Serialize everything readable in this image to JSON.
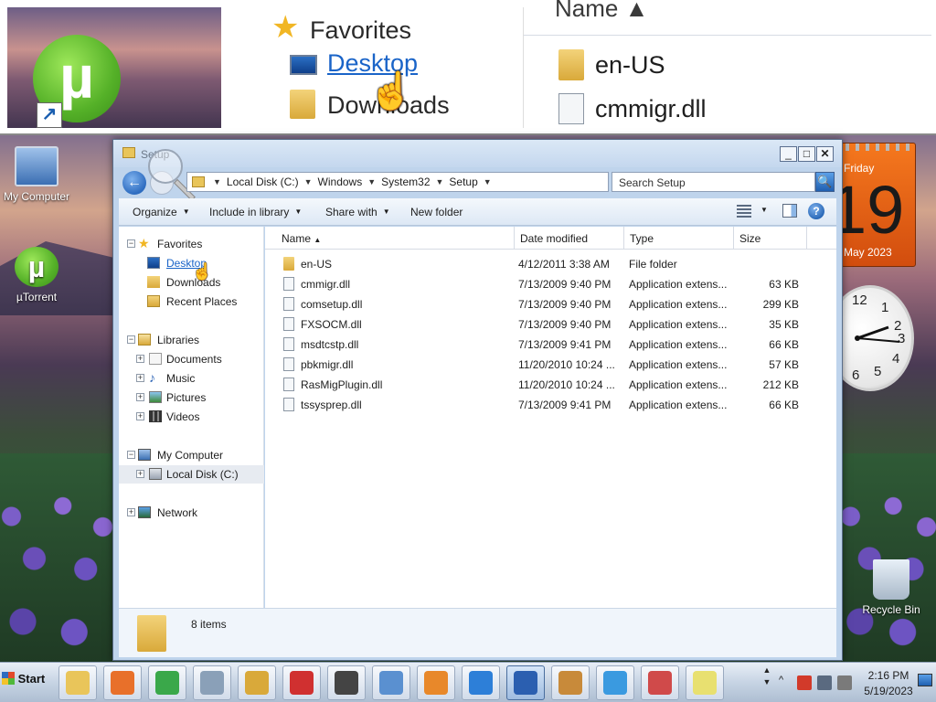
{
  "zoom": {
    "favorites_label": "Favorites",
    "desktop_label": "Desktop",
    "downloads_label": "Downloads",
    "name_header": "Name",
    "file1": "en-US",
    "file2": "cmmigr.dll"
  },
  "desktop": {
    "icons": [
      {
        "label": "My Computer",
        "icon": "computer-icon"
      },
      {
        "label": "µTorrent",
        "icon": "utorrent-icon"
      },
      {
        "label": "Recycle Bin",
        "icon": "recycle-bin-icon"
      }
    ],
    "calendar": {
      "day": "Friday",
      "date": "19",
      "month": "May 2023"
    },
    "clock_numbers": [
      "12",
      "1",
      "2",
      "3",
      "4",
      "5",
      "6"
    ]
  },
  "window": {
    "title": "Setup",
    "buttons": {
      "minimize": "_",
      "maximize": "□",
      "close": "✕"
    },
    "breadcrumbs": [
      "Local Disk (C:)",
      "Windows",
      "System32",
      "Setup"
    ],
    "search_placeholder": "Search Setup",
    "toolbar": {
      "organize": "Organize",
      "include_in_library": "Include in library",
      "share_with": "Share with",
      "new_folder": "New folder"
    },
    "nav": {
      "favorites": "Favorites",
      "desktop": "Desktop",
      "downloads": "Downloads",
      "recent_places": "Recent Places",
      "libraries": "Libraries",
      "documents": "Documents",
      "music": "Music",
      "pictures": "Pictures",
      "videos": "Videos",
      "my_computer": "My Computer",
      "local_disk": "Local Disk (C:)",
      "network": "Network"
    },
    "columns": {
      "name": "Name",
      "date": "Date modified",
      "type": "Type",
      "size": "Size"
    },
    "files": [
      {
        "name": "en-US",
        "date": "4/12/2011 3:38 AM",
        "type": "File folder",
        "size": "",
        "kind": "folder"
      },
      {
        "name": "cmmigr.dll",
        "date": "7/13/2009 9:40 PM",
        "type": "Application extens...",
        "size": "63 KB",
        "kind": "dll"
      },
      {
        "name": "comsetup.dll",
        "date": "7/13/2009 9:40 PM",
        "type": "Application extens...",
        "size": "299 KB",
        "kind": "dll"
      },
      {
        "name": "FXSOCM.dll",
        "date": "7/13/2009 9:40 PM",
        "type": "Application extens...",
        "size": "35 KB",
        "kind": "dll"
      },
      {
        "name": "msdtcstp.dll",
        "date": "7/13/2009 9:41 PM",
        "type": "Application extens...",
        "size": "66 KB",
        "kind": "dll"
      },
      {
        "name": "pbkmigr.dll",
        "date": "11/20/2010 10:24 ...",
        "type": "Application extens...",
        "size": "57 KB",
        "kind": "dll"
      },
      {
        "name": "RasMigPlugin.dll",
        "date": "11/20/2010 10:24 ...",
        "type": "Application extens...",
        "size": "212 KB",
        "kind": "dll"
      },
      {
        "name": "tssysprep.dll",
        "date": "7/13/2009 9:41 PM",
        "type": "Application extens...",
        "size": "66 KB",
        "kind": "dll"
      }
    ],
    "status": "8 items"
  },
  "taskbar": {
    "start_label": "Start",
    "apps": [
      {
        "name": "explorer",
        "icon": "folder-icon",
        "color": "#e9c55a"
      },
      {
        "name": "firefox",
        "icon": "firefox-icon",
        "color": "#e8702a"
      },
      {
        "name": "chrome",
        "icon": "chrome-icon",
        "color": "#3aa84a"
      },
      {
        "name": "calculator",
        "icon": "calculator-icon",
        "color": "#8aa0b8"
      },
      {
        "name": "solitaire-king",
        "icon": "king-card-icon",
        "color": "#d9a93a"
      },
      {
        "name": "hearts",
        "icon": "hearts-icon",
        "color": "#d03030"
      },
      {
        "name": "spider",
        "icon": "spade-card-icon",
        "color": "#444444"
      },
      {
        "name": "control-panel",
        "icon": "control-panel-icon",
        "color": "#5a90d0"
      },
      {
        "name": "media-player",
        "icon": "media-player-icon",
        "color": "#e8882a"
      },
      {
        "name": "internet-explorer",
        "icon": "ie-icon",
        "color": "#2d7fd8"
      },
      {
        "name": "remote-desktop",
        "icon": "remote-desktop-icon",
        "color": "#2b5fb0"
      },
      {
        "name": "paint",
        "icon": "paint-icon",
        "color": "#c88a3a"
      },
      {
        "name": "telegram",
        "icon": "paper-plane-icon",
        "color": "#3a9ae0"
      },
      {
        "name": "snipping-tool",
        "icon": "scissors-icon",
        "color": "#d04a4a"
      },
      {
        "name": "sticky-notes",
        "icon": "sticky-notes-icon",
        "color": "#e8e070"
      }
    ],
    "time": "2:16 PM",
    "date": "5/19/2023"
  }
}
